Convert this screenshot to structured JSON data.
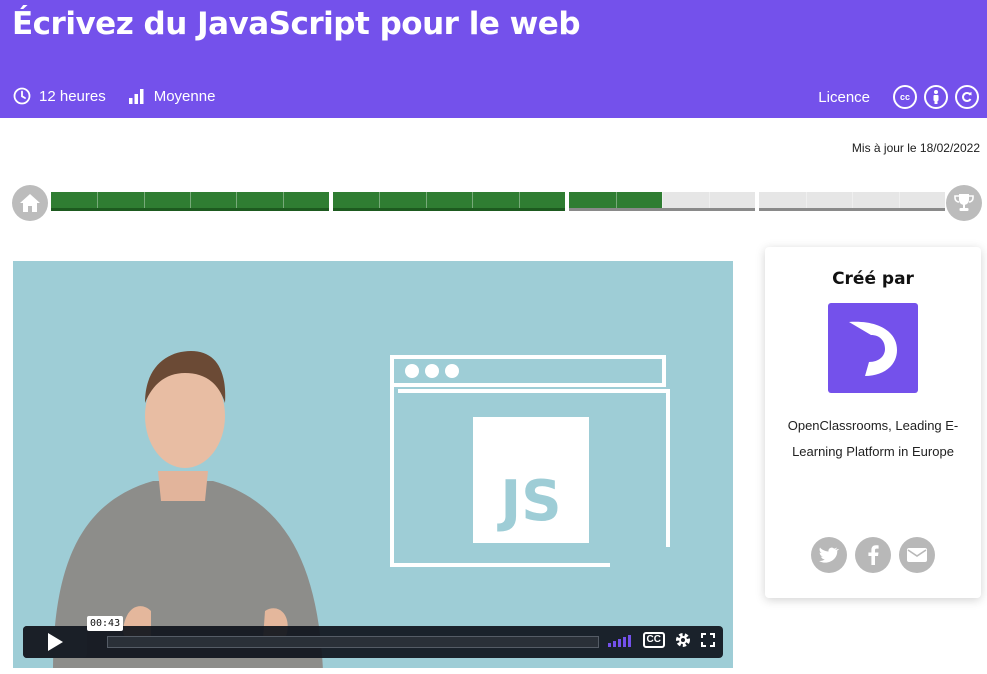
{
  "course": {
    "title": "Écrivez du JavaScript pour le web",
    "duration": "12 heures",
    "difficulty": "Moyenne",
    "license_label": "Licence",
    "license_icons": [
      "cc-icon",
      "by-icon",
      "sa-icon"
    ],
    "updated": "Mis à jour le 18/02/2022"
  },
  "progress": {
    "parts": [
      {
        "completed": 1.0
      },
      {
        "completed": 1.0
      },
      {
        "completed": 0.5
      },
      {
        "completed": 0.0
      }
    ]
  },
  "video": {
    "current_time": "00:43",
    "logo_text": "JS",
    "controls": [
      "play-icon",
      "volume-icon",
      "captions-icon",
      "settings-icon",
      "fullscreen-icon"
    ],
    "captions_label": "CC"
  },
  "creator": {
    "heading": "Créé par",
    "name": "OpenClassrooms, Leading E-Learning Platform in Europe",
    "share": [
      "twitter-icon",
      "facebook-icon",
      "email-icon"
    ]
  },
  "colors": {
    "brand": "#7451eb",
    "progress_fill": "#2f7d32",
    "video_bg": "#9ecdd6"
  }
}
